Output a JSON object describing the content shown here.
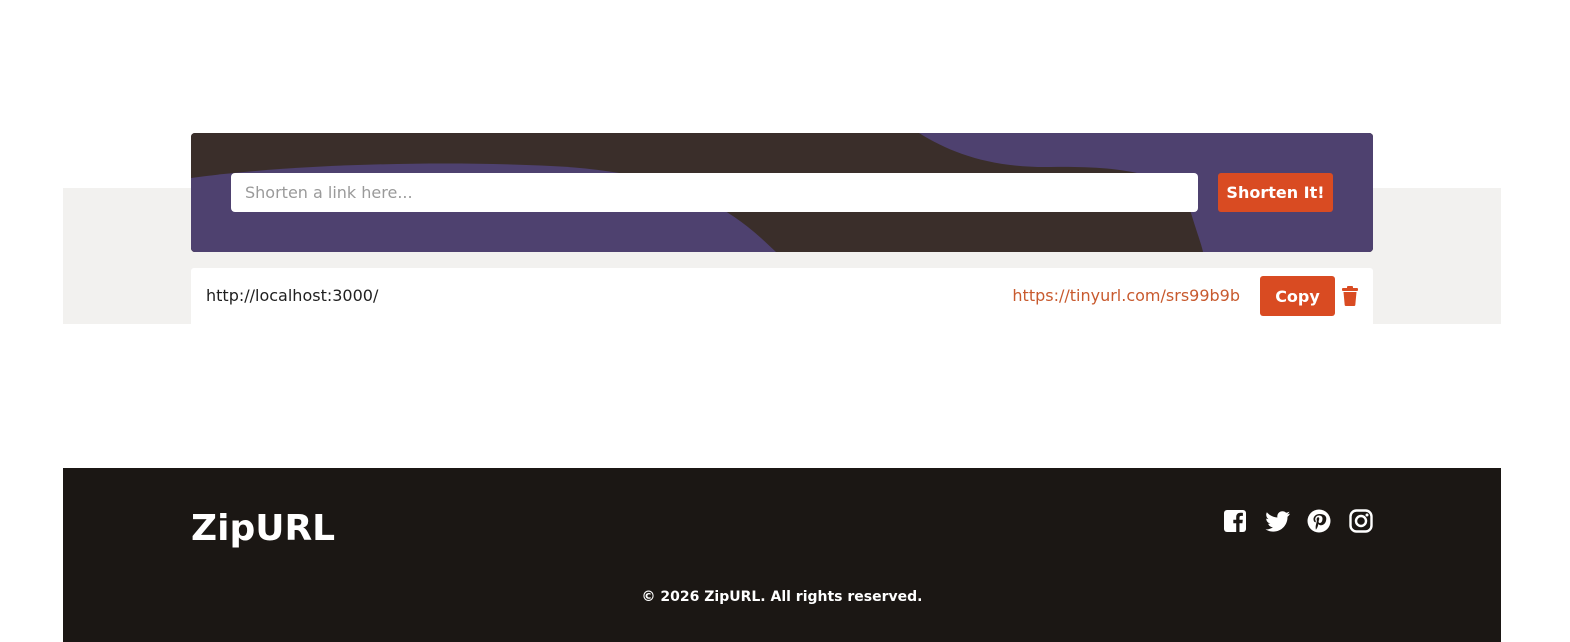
{
  "shortener": {
    "input_placeholder": "Shorten a link here...",
    "input_value": "",
    "button_label": "Shorten It!"
  },
  "results": [
    {
      "original_url": "http://localhost:3000/",
      "short_url": "https://tinyurl.com/srs99b9b",
      "copy_label": "Copy",
      "delete_icon": "trash-icon"
    }
  ],
  "footer": {
    "brand": "ZipURL",
    "social_icons": [
      "facebook-icon",
      "twitter-icon",
      "pinterest-icon",
      "instagram-icon"
    ],
    "copyright": "© 2026 ZipURL. All rights reserved."
  },
  "colors": {
    "accent": "#d94b22",
    "short_link": "#c85a2e",
    "card_purple": "#4e416f",
    "card_dark": "#3a2e2a",
    "footer_bg": "#1b1714"
  }
}
